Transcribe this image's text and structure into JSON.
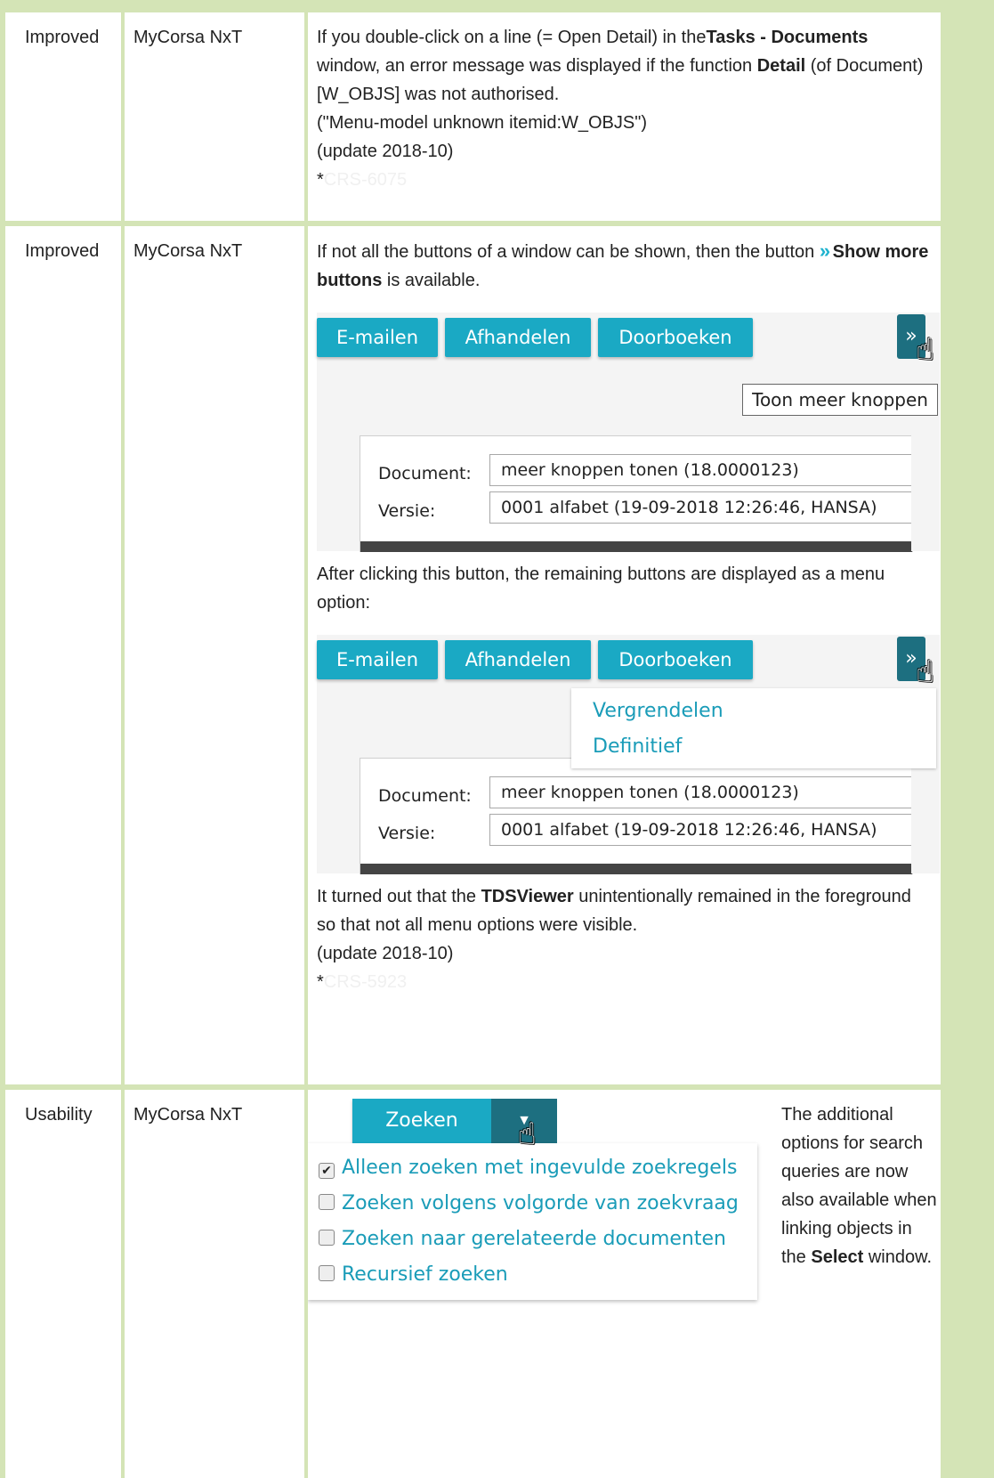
{
  "rows": [
    {
      "type": "Improved",
      "product": "MyCorsa NxT",
      "lines": [
        "If you double-click on a line (= Open Detail) in the",
        "Tasks - Documents",
        " window, an error message was displayed if the function ",
        "Detail",
        " (of Document) [W_OBJS] was not authorised.",
        "(\"Menu-model unknown itemid:W_OBJS\")",
        "(update 2018-10)"
      ],
      "ref": "CRS-6075"
    },
    {
      "type": "Improved",
      "product": "MyCorsa NxT",
      "intro_a": "If not all the buttons of a window can be shown, then the button ",
      "intro_bold": "Show more buttons",
      "intro_b": " is available.",
      "shot1": {
        "buttons": [
          "E-mailen",
          "Afhandelen",
          "Doorboeken"
        ],
        "tooltip": "Toon meer knoppen",
        "doc_label": "Document:",
        "doc_value": "meer knoppen tonen (18.0000123)",
        "ver_label": "Versie:",
        "ver_value": "0001 alfabet (19-09-2018 12:26:46, HANSA)"
      },
      "mid_text": "After clicking this button, the remaining buttons are displayed as a menu option:",
      "shot2": {
        "buttons": [
          "E-mailen",
          "Afhandelen",
          "Doorboeken"
        ],
        "menu": [
          "Vergrendelen",
          "Definitief"
        ],
        "doc_label": "Document:",
        "doc_value": "meer knoppen tonen (18.0000123)",
        "ver_label": "Versie:",
        "ver_value": "0001 alfabet (19-09-2018 12:26:46, HANSA)"
      },
      "end_a": "It turned out that the ",
      "end_bold": "TDSViewer",
      "end_b": " unintentionally remained in the foreground so that not all menu options were visible.",
      "update": "(update 2018-10)",
      "ref": "CRS-5923"
    },
    {
      "type": "Usability",
      "product": "MyCorsa NxT",
      "search_btn": "Zoeken",
      "options": [
        {
          "label": "Alleen zoeken met ingevulde zoekregels",
          "checked": true
        },
        {
          "label": "Zoeken volgens volgorde van zoekvraag",
          "checked": false
        },
        {
          "label": "Zoeken naar gerelateerde documenten",
          "checked": false
        },
        {
          "label": "Recursief zoeken",
          "checked": false
        }
      ],
      "desc_a": "The additional options for search queries are now also available when linking objects in the ",
      "desc_bold": "Select",
      "desc_b": " window."
    }
  ],
  "colors": {
    "border": "#d4e4b6",
    "accent": "#1aa9c4",
    "dark": "#1d6f80"
  }
}
